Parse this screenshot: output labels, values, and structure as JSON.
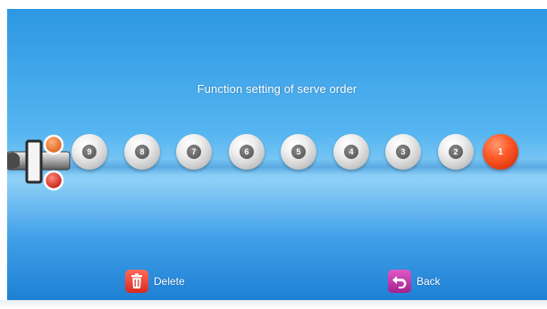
{
  "screen": {
    "title": "Function setting of serve order",
    "balls": [
      {
        "number": "9",
        "active": false
      },
      {
        "number": "8",
        "active": false
      },
      {
        "number": "7",
        "active": false
      },
      {
        "number": "6",
        "active": false
      },
      {
        "number": "5",
        "active": false
      },
      {
        "number": "4",
        "active": false
      },
      {
        "number": "3",
        "active": false
      },
      {
        "number": "2",
        "active": false
      },
      {
        "number": "1",
        "active": true
      }
    ]
  },
  "actions": {
    "delete_label": "Delete",
    "back_label": "Back"
  },
  "icons": {
    "delete": "trash-icon",
    "back": "back-arrow-icon",
    "launcher": "ball-launcher-icon"
  },
  "colors": {
    "active_ball": "#ff5a2a",
    "inactive_ball": "#d9d9d9",
    "delete_button": "#e0392b",
    "back_button": "#c03aa8"
  }
}
